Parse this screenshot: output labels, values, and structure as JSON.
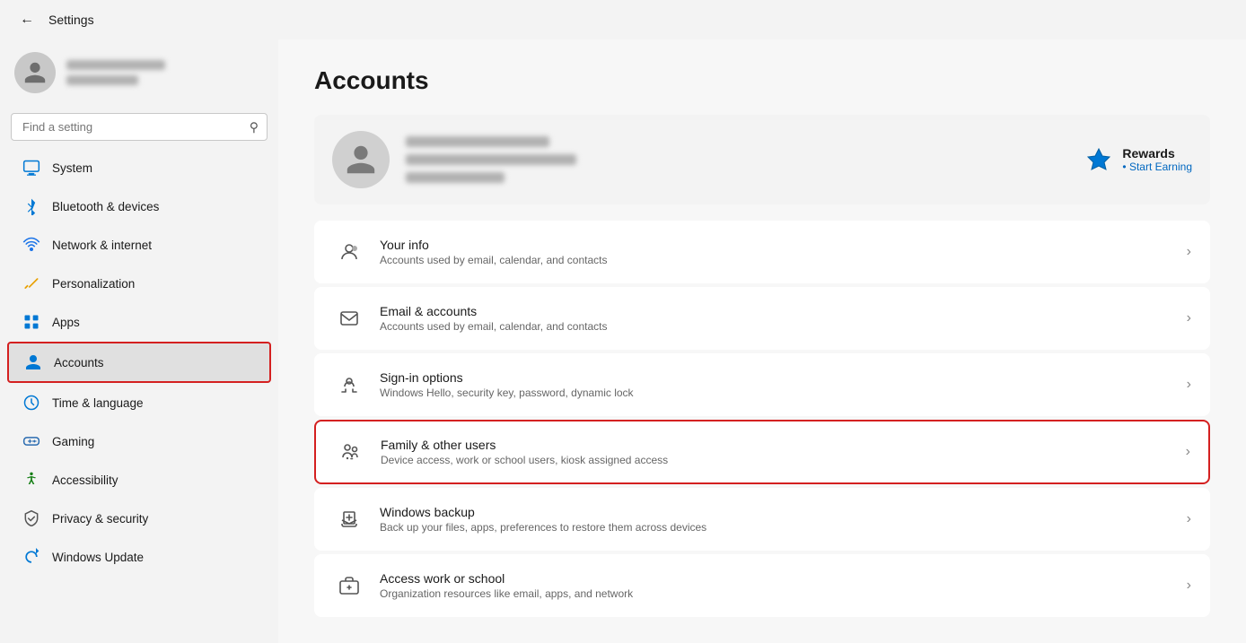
{
  "titleBar": {
    "backLabel": "←",
    "title": "Settings"
  },
  "sidebar": {
    "searchPlaceholder": "Find a setting",
    "searchIcon": "🔍",
    "user": {
      "nameBlurWidths": [
        120,
        90,
        70
      ]
    },
    "navItems": [
      {
        "id": "system",
        "label": "System",
        "icon": "system",
        "active": false
      },
      {
        "id": "bluetooth",
        "label": "Bluetooth & devices",
        "icon": "bluetooth",
        "active": false
      },
      {
        "id": "network",
        "label": "Network & internet",
        "icon": "network",
        "active": false
      },
      {
        "id": "personalization",
        "label": "Personalization",
        "icon": "personalization",
        "active": false
      },
      {
        "id": "apps",
        "label": "Apps",
        "icon": "apps",
        "active": false
      },
      {
        "id": "accounts",
        "label": "Accounts",
        "icon": "accounts",
        "active": true
      },
      {
        "id": "time",
        "label": "Time & language",
        "icon": "time",
        "active": false
      },
      {
        "id": "gaming",
        "label": "Gaming",
        "icon": "gaming",
        "active": false
      },
      {
        "id": "accessibility",
        "label": "Accessibility",
        "icon": "accessibility",
        "active": false
      },
      {
        "id": "privacy",
        "label": "Privacy & security",
        "icon": "privacy",
        "active": false
      },
      {
        "id": "update",
        "label": "Windows Update",
        "icon": "update",
        "active": false
      }
    ]
  },
  "content": {
    "pageTitle": "Accounts",
    "rewards": {
      "title": "Rewards",
      "subtitle": "Start Earning",
      "dotSymbol": "•"
    },
    "settingsCards": [
      {
        "id": "your-info",
        "title": "Your info",
        "subtitle": "Accounts used by email, calendar, and contacts",
        "highlighted": false
      },
      {
        "id": "email-accounts",
        "title": "Email & accounts",
        "subtitle": "Accounts used by email, calendar, and contacts",
        "highlighted": false
      },
      {
        "id": "signin-options",
        "title": "Sign-in options",
        "subtitle": "Windows Hello, security key, password, dynamic lock",
        "highlighted": false
      },
      {
        "id": "family-users",
        "title": "Family & other users",
        "subtitle": "Device access, work or school users, kiosk assigned access",
        "highlighted": true
      },
      {
        "id": "windows-backup",
        "title": "Windows backup",
        "subtitle": "Back up your files, apps, preferences to restore them across devices",
        "highlighted": false
      },
      {
        "id": "access-work",
        "title": "Access work or school",
        "subtitle": "Organization resources like email, apps, and network",
        "highlighted": false
      }
    ]
  }
}
